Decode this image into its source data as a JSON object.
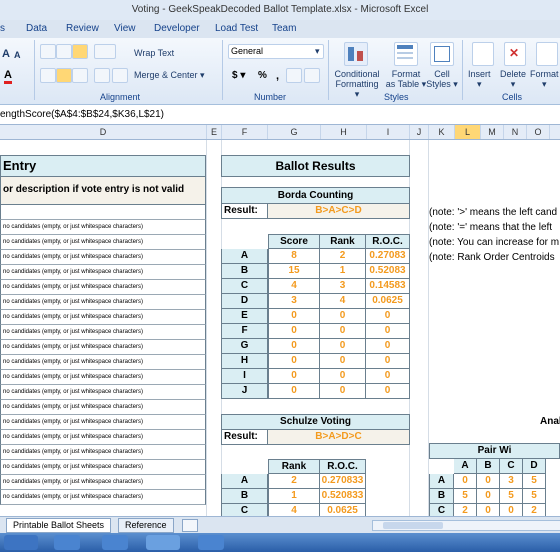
{
  "window_title": "Voting - GeekSpeakDecoded Ballot Template.xlsx - Microsoft Excel",
  "menu": [
    "s",
    "Data",
    "Review",
    "View",
    "Developer",
    "Load Test",
    "Team"
  ],
  "ribbon": {
    "font_size_up": "A",
    "font_size_down": "A",
    "wrap_text": "Wrap Text",
    "merge_center": "Merge & Center",
    "number_format": "General",
    "currency": "$",
    "percent": "%",
    "comma": ",",
    "conditional_formatting": [
      "Conditional",
      "Formatting"
    ],
    "format_as_table": [
      "Format",
      "as Table"
    ],
    "cell_styles": [
      "Cell",
      "Styles"
    ],
    "insert": "Insert",
    "delete": "Delete",
    "format": "Format",
    "groups": {
      "alignment": "Alignment",
      "number": "Number",
      "styles": "Styles",
      "cells": "Cells"
    }
  },
  "formula": "engthScore($A$4:$B$24,$K36,L$21)",
  "columns": [
    "D",
    "E",
    "F",
    "G",
    "H",
    "I",
    "J",
    "K",
    "L",
    "M",
    "N",
    "O"
  ],
  "left_panel": {
    "title": "Entry",
    "subtitle": "or description if vote entry is not valid",
    "row_note": "no candidates (empty, or just whitespace characters)"
  },
  "ballot_results": {
    "title": "Ballot Results",
    "borda_title": "Borda Counting",
    "result_label": "Result:",
    "borda_result": "B>A>C>D",
    "headers": [
      "Score",
      "Rank",
      "R.O.C."
    ],
    "rows": [
      {
        "c": "A",
        "score": "8",
        "rank": "2",
        "roc": "0.27083"
      },
      {
        "c": "B",
        "score": "15",
        "rank": "1",
        "roc": "0.52083"
      },
      {
        "c": "C",
        "score": "4",
        "rank": "3",
        "roc": "0.14583"
      },
      {
        "c": "D",
        "score": "3",
        "rank": "4",
        "roc": "0.0625"
      },
      {
        "c": "E",
        "score": "0",
        "rank": "0",
        "roc": "0"
      },
      {
        "c": "F",
        "score": "0",
        "rank": "0",
        "roc": "0"
      },
      {
        "c": "G",
        "score": "0",
        "rank": "0",
        "roc": "0"
      },
      {
        "c": "H",
        "score": "0",
        "rank": "0",
        "roc": "0"
      },
      {
        "c": "I",
        "score": "0",
        "rank": "0",
        "roc": "0"
      },
      {
        "c": "J",
        "score": "0",
        "rank": "0",
        "roc": "0"
      }
    ],
    "schulze_title": "Schulze Voting",
    "schulze_result": "B>A>D>C",
    "schulze_headers": [
      "Rank",
      "R.O.C."
    ],
    "schulze_rows": [
      {
        "c": "A",
        "rank": "2",
        "roc": "0.270833"
      },
      {
        "c": "B",
        "rank": "1",
        "roc": "0.520833"
      },
      {
        "c": "C",
        "rank": "4",
        "roc": "0.0625"
      }
    ]
  },
  "notes": [
    "(note: '>' means the left cand",
    "(note: '=' means that the left",
    "(note: You can increase for m",
    "(note: Rank Order Centroids"
  ],
  "analysis_label": "Anal",
  "pair_wins": {
    "title": "Pair Wi",
    "headers": [
      "A",
      "B",
      "C",
      "D"
    ],
    "rows": [
      {
        "c": "A",
        "v": [
          "0",
          "0",
          "3",
          "5"
        ]
      },
      {
        "c": "B",
        "v": [
          "5",
          "0",
          "5",
          "5"
        ]
      },
      {
        "c": "C",
        "v": [
          "2",
          "0",
          "0",
          "2"
        ]
      }
    ]
  },
  "sheet_tabs": [
    "Printable Ballot Sheets",
    "Reference"
  ],
  "colors": {
    "orange": "#f39a1e",
    "header_blue": "#daeef3",
    "result_bg": "#f5f2ea"
  }
}
